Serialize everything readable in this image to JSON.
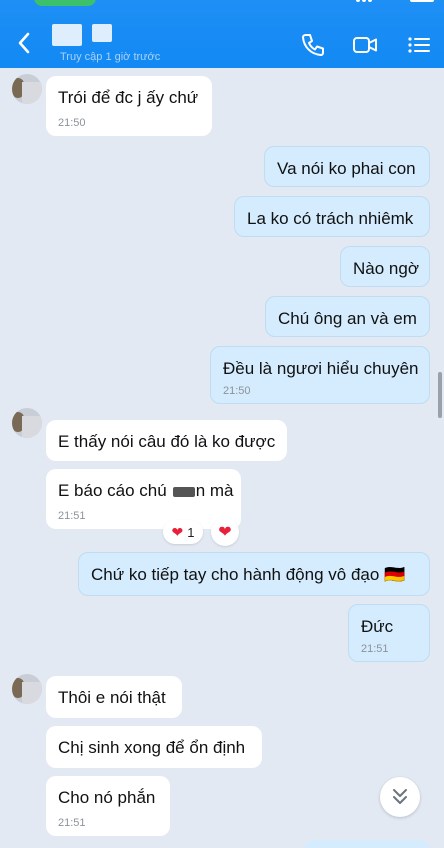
{
  "header": {
    "subtitle": "Truy cập 1 giờ trước",
    "icons": [
      "back-arrow-icon",
      "phone-icon",
      "video-call-icon",
      "menu-list-icon"
    ]
  },
  "messages": [
    {
      "id": "m1",
      "text": "Trói để đc j ấy chứ",
      "time": "21:50"
    },
    {
      "id": "m2",
      "text": "Va nói ko phai con"
    },
    {
      "id": "m3",
      "text": "La ko có trách nhiêmk"
    },
    {
      "id": "m4",
      "text": "Nào ngờ"
    },
    {
      "id": "m5",
      "text": "Chú ông an và em"
    },
    {
      "id": "m6",
      "text": "Đều là ngươi hiểu chuyên",
      "time": "21:50"
    },
    {
      "id": "m7",
      "text": "E thấy nói câu đó là ko được"
    },
    {
      "id": "m8",
      "text_before": "E báo cáo chú",
      "text_after": "n mà",
      "time": "21:51"
    },
    {
      "id": "m9",
      "text": "Chứ ko tiếp tay cho hành động vô đạo 🇩🇪"
    },
    {
      "id": "m10",
      "text": "Đức",
      "time": "21:51"
    },
    {
      "id": "m11",
      "text": "Thôi e nói thật"
    },
    {
      "id": "m12",
      "text": "Chị sinh xong để ổn định"
    },
    {
      "id": "m13",
      "text": "Cho nó phắn",
      "time": "21:51"
    }
  ],
  "reaction": {
    "emoji": "❤",
    "count": "1"
  },
  "colors": {
    "header": "#1e8ff5",
    "background": "#e2e9f2",
    "outgoing_bubble": "#d4ecfd",
    "incoming_bubble": "#ffffff",
    "heart": "#e8203a"
  }
}
